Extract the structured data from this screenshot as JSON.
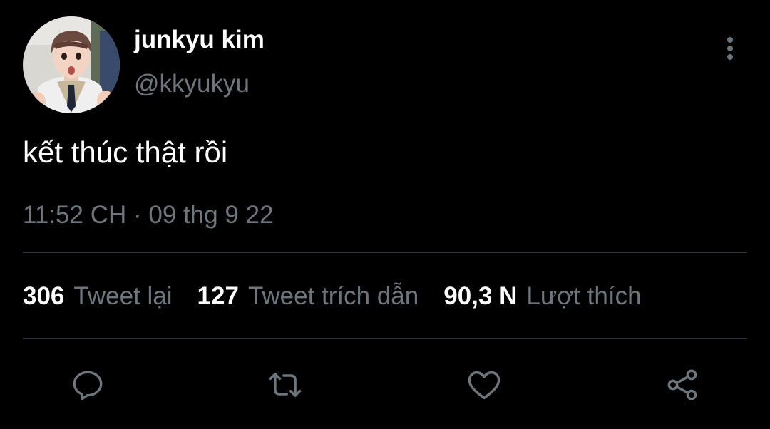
{
  "tweet": {
    "display_name": "junkyu kim",
    "handle": "@kkyukyu",
    "text": "kết thúc thật rồi",
    "time": "11:52 CH",
    "separator": "·",
    "date": "09 thg 9 22"
  },
  "stats": {
    "retweets": {
      "count": "306",
      "label": "Tweet lại"
    },
    "quotes": {
      "count": "127",
      "label": "Tweet trích dẫn"
    },
    "likes": {
      "count": "90,3 N",
      "label": "Lượt thích"
    }
  },
  "actions": [
    {
      "icon": "reply-icon"
    },
    {
      "icon": "retweet-icon"
    },
    {
      "icon": "like-icon"
    },
    {
      "icon": "share-icon"
    }
  ],
  "colors": {
    "background": "#000000",
    "primary_text": "#ffffff",
    "secondary_text": "#6e767d",
    "divider": "#2f3336"
  }
}
